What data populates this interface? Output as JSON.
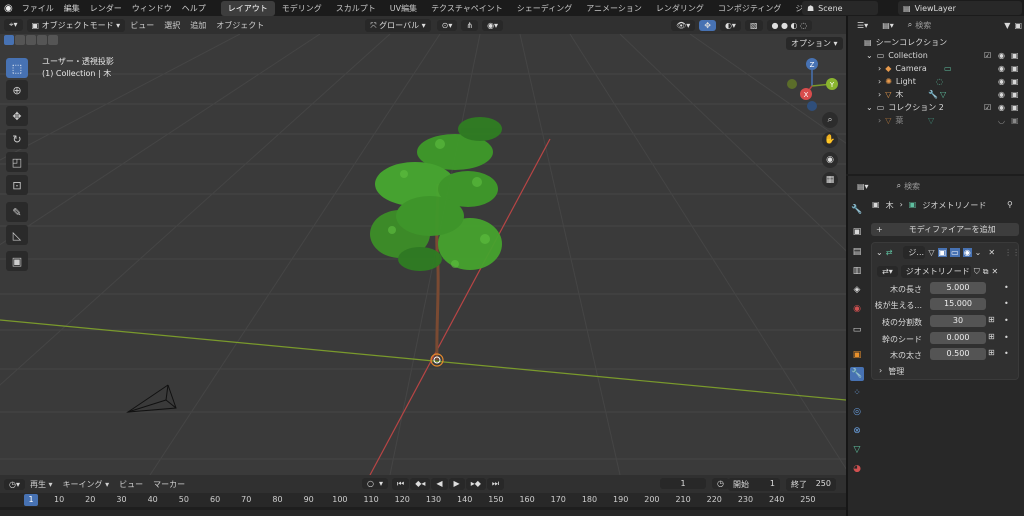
{
  "menus": [
    "ファイル",
    "編集",
    "レンダー",
    "ウィンドウ",
    "ヘルプ"
  ],
  "workspaces": [
    "レイアウト",
    "モデリング",
    "スカルプト",
    "UV編集",
    "テクスチャペイント",
    "シェーディング",
    "アニメーション",
    "レンダリング",
    "コンポジティング",
    "ジオメトリ..."
  ],
  "active_workspace": "レイアウト",
  "scene": "Scene",
  "view_layer": "ViewLayer",
  "viewport_header": {
    "mode": "オブジェクトモード",
    "view": "ビュー",
    "select": "選択",
    "add": "追加",
    "object": "オブジェクト",
    "orientation": "グローバル",
    "options": "オプション"
  },
  "viewport_overlay": {
    "projection": "ユーザー・透視投影",
    "context": "(1) Collection | 木"
  },
  "axes": {
    "x": "X",
    "y": "Y",
    "z": "Z"
  },
  "outliner": {
    "search_placeholder": "検索",
    "root": "シーンコレクション",
    "items": [
      {
        "label": "Collection",
        "level": 1
      },
      {
        "label": "Camera",
        "level": 2
      },
      {
        "label": "Light",
        "level": 2
      },
      {
        "label": "木",
        "level": 2
      },
      {
        "label": "コレクション 2",
        "level": 1
      },
      {
        "label": "葉",
        "level": 2
      }
    ]
  },
  "properties": {
    "search_placeholder": "検索",
    "breadcrumb_object": "木",
    "breadcrumb_modifier": "ジオメトリノード",
    "add_modifier": "モディファイアーを追加",
    "modifier_name": "ジ...",
    "node_group": "ジオメトリノード",
    "inputs": [
      {
        "label": "木の長さ",
        "value": "5.000"
      },
      {
        "label": "枝が生える...",
        "value": "15.000"
      },
      {
        "label": "枝の分割数",
        "value": "30"
      },
      {
        "label": "幹のシード",
        "value": "0.000"
      },
      {
        "label": "木の太さ",
        "value": "0.500"
      }
    ],
    "manage": "管理"
  },
  "timeline": {
    "playback": "再生",
    "keying": "キーイング",
    "view": "ビュー",
    "marker": "マーカー",
    "current_frame": "1",
    "start_label": "開始",
    "start": "1",
    "end_label": "終了",
    "end": "250",
    "ticks": [
      "1",
      "10",
      "20",
      "30",
      "40",
      "50",
      "60",
      "70",
      "80",
      "90",
      "100",
      "110",
      "120",
      "130",
      "140",
      "150",
      "160",
      "170",
      "180",
      "190",
      "200",
      "210",
      "220",
      "230",
      "240",
      "250"
    ]
  },
  "colors": {
    "accent": "#4772b3",
    "x_axis": "#b84545",
    "y_axis": "#7a9a2c",
    "tree_green": "#3f9a2a"
  }
}
